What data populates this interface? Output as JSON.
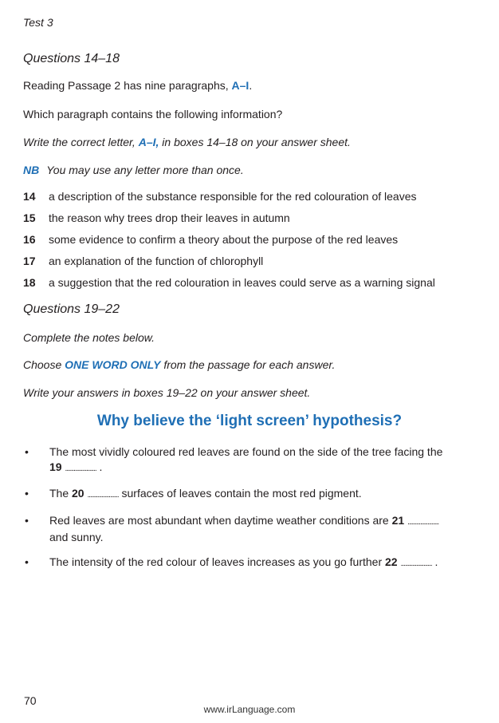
{
  "header": {
    "test_label": "Test 3"
  },
  "section1": {
    "heading": "Questions 14–18",
    "intro_text": "Reading Passage 2 has nine paragraphs, ",
    "intro_range": "A–I",
    "intro_end": ".",
    "question_line": "Which paragraph contains the following information?",
    "instruction_start": "Write the correct letter, ",
    "instruction_range": "A–I,",
    "instruction_end": " in boxes 14–18 on your answer sheet.",
    "nb_label": "NB",
    "nb_text": "You may use any letter more than once.",
    "questions": [
      {
        "num": "14",
        "text": "a description of the substance responsible for the red colouration of leaves"
      },
      {
        "num": "15",
        "text": "the reason why trees drop their leaves in autumn"
      },
      {
        "num": "16",
        "text": "some evidence to confirm a theory about the purpose of the red leaves"
      },
      {
        "num": "17",
        "text": "an explanation of the function of chlorophyll"
      },
      {
        "num": "18",
        "text": "a suggestion that the red colouration in leaves could serve as a warning signal"
      }
    ]
  },
  "section2": {
    "heading": "Questions 19–22",
    "complete_line": "Complete the notes below.",
    "choose_start": "Choose ",
    "choose_emph": "ONE WORD ONLY",
    "choose_end": " from the passage for each answer.",
    "write_line": "Write your answers in boxes 19–22 on your answer sheet.",
    "notes_title": "Why believe the ‘light screen’ hypothesis?",
    "bullet": "•",
    "gap_dots": "......................",
    "notes": [
      {
        "line1": "The most vividly coloured red leaves are found on the side of the tree facing the",
        "gap": "19",
        "end": " ."
      },
      {
        "start": "The ",
        "gap": "20",
        "end": " surfaces of leaves contain the most red pigment."
      },
      {
        "start": "Red leaves are most abundant when daytime weather conditions are ",
        "gap": "21",
        "line2": "and sunny."
      },
      {
        "start": "The intensity of the red colour of leaves increases as you go further ",
        "gap": "22",
        "end": " ."
      }
    ]
  },
  "footer": {
    "page_number": "70",
    "website": "www.irLanguage.com"
  }
}
